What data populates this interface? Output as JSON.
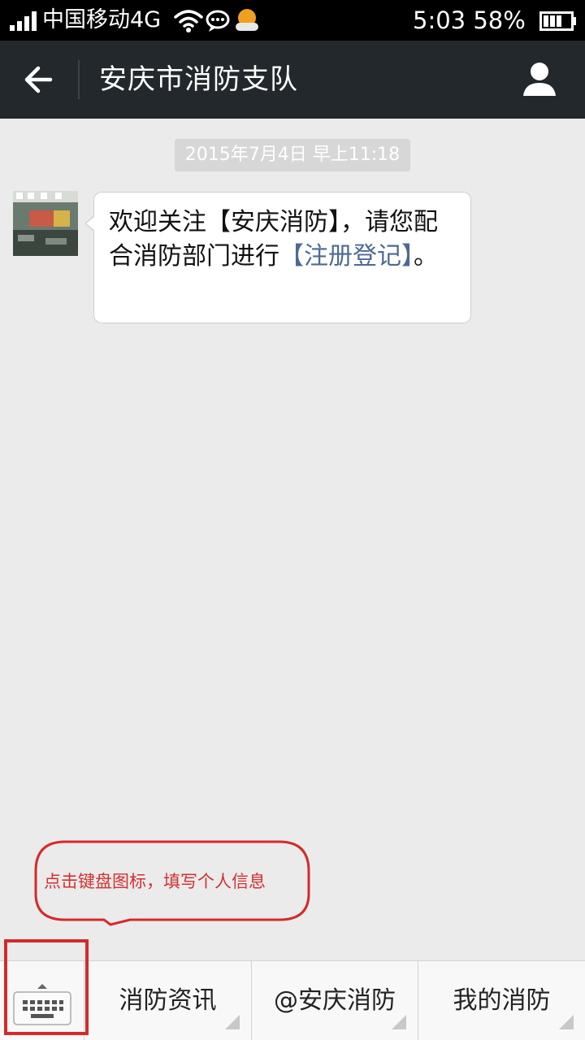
{
  "status_bar": {
    "carrier": "中国移动4G",
    "time": "5:03",
    "battery": "58%",
    "icons": [
      "signal-icon",
      "wifi-icon",
      "chat-icon",
      "weather-icon",
      "battery-icon"
    ]
  },
  "header": {
    "title": "安庆市消防支队",
    "back_icon": "arrow-left-icon",
    "profile_icon": "user-icon"
  },
  "chat": {
    "timestamp": "2015年7月4日 早上11:18",
    "message": {
      "text_before": "欢迎关注【安庆消防】，请您配合消防部门进行",
      "link_text": "【注册登记】",
      "text_after": "。"
    }
  },
  "annotation": {
    "text": "点击键盘图标，填写个人信息",
    "color": "#d43030"
  },
  "menu": {
    "keyboard_icon": "keyboard-icon",
    "items": [
      {
        "label": "消防资讯"
      },
      {
        "label": "@安庆消防"
      },
      {
        "label": "我的消防"
      }
    ]
  },
  "colors": {
    "header_bg": "#22282b",
    "chat_bg": "#ebebeb",
    "link": "#4d6a94",
    "highlight": "#d42a2a"
  }
}
